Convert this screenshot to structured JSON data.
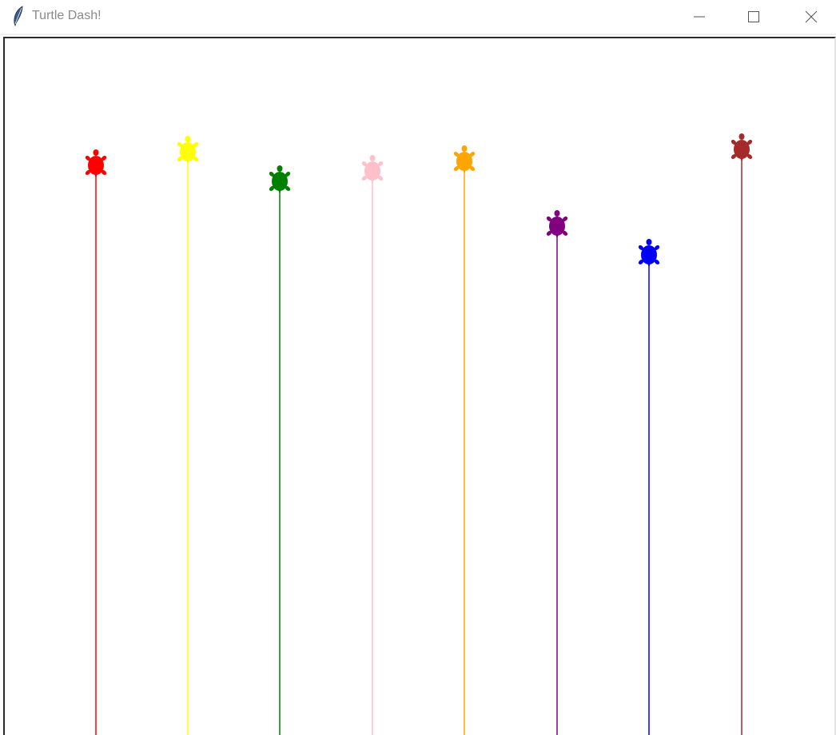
{
  "window": {
    "title": "Turtle Dash!",
    "app_icon": "feather-icon",
    "controls": [
      "minimize-icon",
      "maximize-icon",
      "close-icon"
    ]
  },
  "race": {
    "turtles": [
      {
        "color": "#ff0000",
        "name": "red"
      },
      {
        "color": "#ffff00",
        "name": "yellow"
      },
      {
        "color": "#008000",
        "name": "green"
      },
      {
        "color": "#ffc0cb",
        "name": "pink"
      },
      {
        "color": "#ffa500",
        "name": "orange"
      },
      {
        "color": "#800080",
        "name": "purple"
      },
      {
        "color": "#0000ff",
        "name": "blue"
      },
      {
        "color": "#a52a2a",
        "name": "brown"
      }
    ]
  }
}
